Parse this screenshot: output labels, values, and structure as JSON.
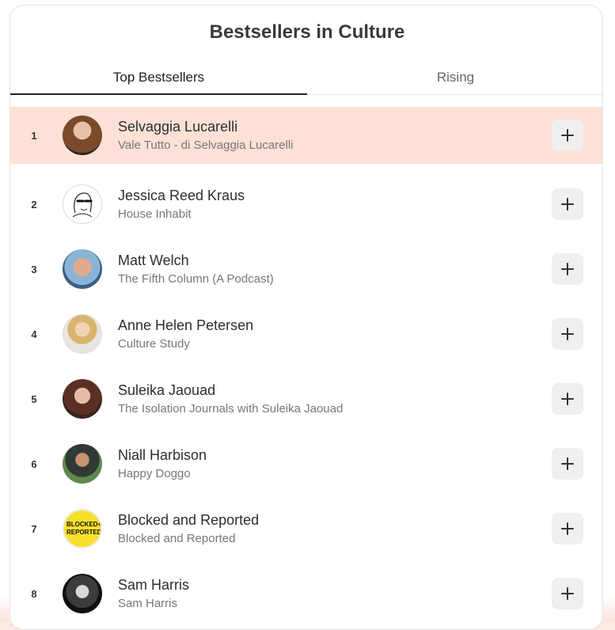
{
  "page": {
    "title": "Bestsellers in Culture"
  },
  "tabs": [
    {
      "label": "Top Bestsellers",
      "active": true
    },
    {
      "label": "Rising",
      "active": false
    }
  ],
  "entries": [
    {
      "rank": "1",
      "name": "Selvaggia Lucarelli",
      "publication": "Vale Tutto - di Selvaggia Lucarelli",
      "highlighted": true
    },
    {
      "rank": "2",
      "name": "Jessica Reed Kraus",
      "publication": "House Inhabit"
    },
    {
      "rank": "3",
      "name": "Matt Welch",
      "publication": "The Fifth Column (A Podcast)"
    },
    {
      "rank": "4",
      "name": "Anne Helen Petersen",
      "publication": "Culture Study"
    },
    {
      "rank": "5",
      "name": "Suleika Jaouad",
      "publication": "The Isolation Journals with Suleika Jaouad"
    },
    {
      "rank": "6",
      "name": "Niall Harbison",
      "publication": "Happy Doggo"
    },
    {
      "rank": "7",
      "name": "Blocked and Reported",
      "publication": "Blocked and Reported",
      "avatar_text": "BLOCKED+ REPORTED"
    },
    {
      "rank": "8",
      "name": "Sam Harris",
      "publication": "Sam Harris"
    }
  ],
  "colors": {
    "highlight": "#fde1d6",
    "button_bg": "#efefef",
    "active_tab_underline": "#222222"
  },
  "icons": {
    "follow_button": "plus-icon"
  }
}
